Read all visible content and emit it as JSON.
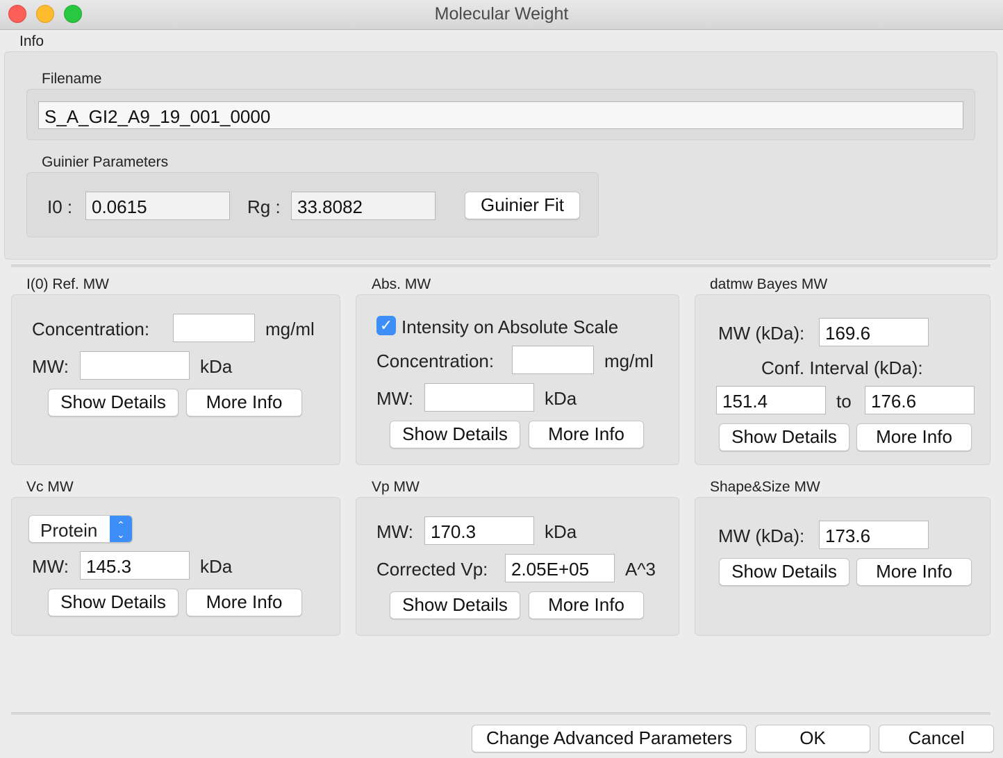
{
  "window": {
    "title": "Molecular Weight"
  },
  "info": {
    "label": "Info",
    "filename_label": "Filename",
    "filename": "S_A_GI2_A9_19_001_0000",
    "guinier_label": "Guinier Parameters",
    "i0_label": "I0 :",
    "i0_value": "0.0615",
    "rg_label": "Rg :",
    "rg_value": "33.8082",
    "guinier_fit_button": "Guinier Fit"
  },
  "i0_ref": {
    "title": "I(0) Ref. MW",
    "conc_label": "Concentration:",
    "conc_value": "",
    "conc_unit": "mg/ml",
    "mw_label": "MW:",
    "mw_value": "",
    "mw_unit": "kDa",
    "show_details": "Show Details",
    "more_info": "More Info"
  },
  "abs": {
    "title": "Abs. MW",
    "checkbox_label": "Intensity on Absolute Scale",
    "checked": true,
    "conc_label": "Concentration:",
    "conc_value": "",
    "conc_unit": "mg/ml",
    "mw_label": "MW:",
    "mw_value": "",
    "mw_unit": "kDa",
    "show_details": "Show Details",
    "more_info": "More Info"
  },
  "datmw": {
    "title": "datmw Bayes MW",
    "mw_label": "MW (kDa):",
    "mw_value": "169.6",
    "conf_label": "Conf. Interval (kDa):",
    "conf_low": "151.4",
    "to_label": "to",
    "conf_high": "176.6",
    "show_details": "Show Details",
    "more_info": "More Info"
  },
  "vc": {
    "title": "Vc MW",
    "type_selected": "Protein",
    "mw_label": "MW:",
    "mw_value": "145.3",
    "mw_unit": "kDa",
    "show_details": "Show Details",
    "more_info": "More Info"
  },
  "vp": {
    "title": "Vp MW",
    "mw_label": "MW:",
    "mw_value": "170.3",
    "mw_unit": "kDa",
    "vp_label": "Corrected Vp:",
    "vp_value": "2.05E+05",
    "vp_unit": "A^3",
    "show_details": "Show Details",
    "more_info": "More Info"
  },
  "shape": {
    "title": "Shape&Size MW",
    "mw_label": "MW (kDa):",
    "mw_value": "173.6",
    "show_details": "Show Details",
    "more_info": "More Info"
  },
  "footer": {
    "advanced": "Change Advanced Parameters",
    "ok": "OK",
    "cancel": "Cancel"
  },
  "colors": {
    "accent": "#3d8ff7"
  }
}
